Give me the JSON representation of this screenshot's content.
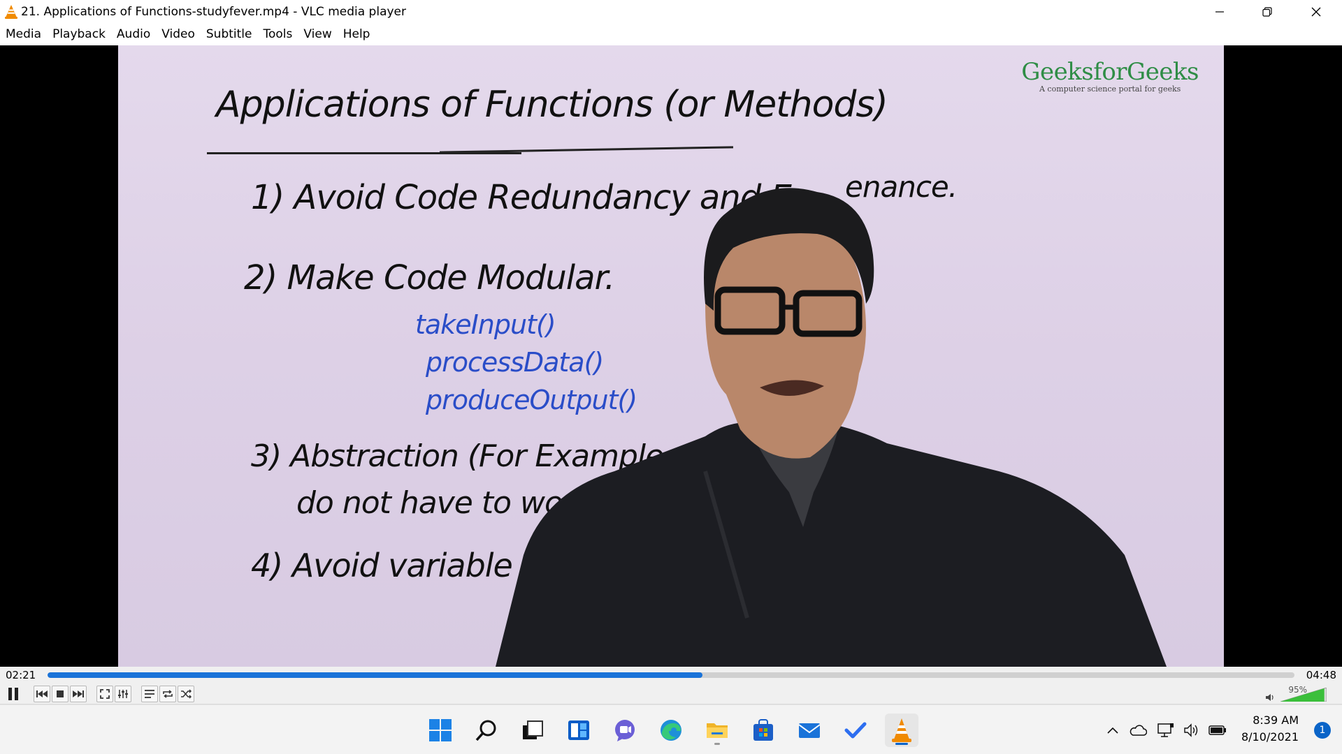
{
  "window": {
    "title": "21. Applications of Functions-studyfever.mp4 - VLC media player",
    "app_icon": "vlc-cone-icon"
  },
  "menu": [
    "Media",
    "Playback",
    "Audio",
    "Video",
    "Subtitle",
    "Tools",
    "View",
    "Help"
  ],
  "video": {
    "logo_name": "GeeksforGeeks",
    "logo_tagline": "A computer science portal for geeks",
    "heading": "Applications of Functions (or Methods)",
    "point1": "1) Avoid Code Redundancy and E",
    "point1_tail": "enance.",
    "point2": "2) Make Code Modular.",
    "code_line1": "takeInput()",
    "code_line2": "processData()",
    "code_line3": "produceOutput()",
    "point3": "3) Abstraction (For Example, in li",
    "point3_line2": "do not have to worry a",
    "point4": "4) Avoid variable nam"
  },
  "player": {
    "elapsed": "02:21",
    "total": "04:48",
    "progress": 0.525,
    "volume_label": "95%",
    "volume": 0.95,
    "accent_color": "#1a73d9"
  },
  "taskbar": {
    "icons": [
      "windows-start-icon",
      "search-icon",
      "task-view-icon",
      "widgets-icon",
      "teams-chat-icon",
      "edge-browser-icon",
      "file-explorer-icon",
      "store-icon",
      "mail-icon",
      "todo-icon",
      "vlc-icon"
    ],
    "time": "8:39 AM",
    "date": "8/10/2021",
    "notification_count": "1"
  }
}
